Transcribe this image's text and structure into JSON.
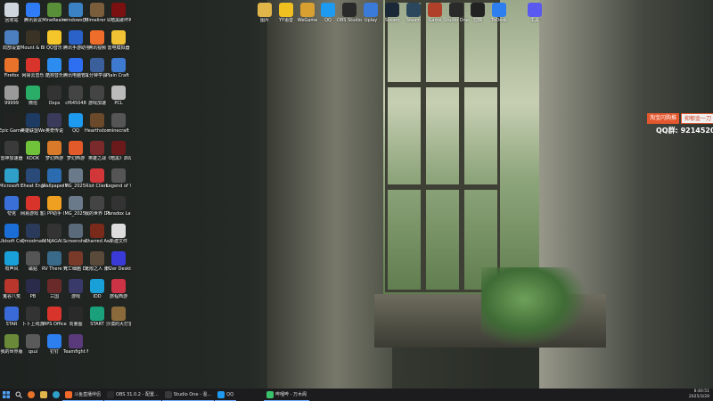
{
  "desktop": {
    "icons_left": [
      {
        "label": "回收站",
        "icon": "recycle-bin-icon",
        "color": "#d0d6de"
      },
      {
        "label": "腾讯会议",
        "icon": "tencent-meeting-icon",
        "color": "#2f7cf6"
      },
      {
        "label": "MineRealm",
        "icon": "minecraft-icon",
        "color": "#5a8f3a"
      },
      {
        "label": "windows优化",
        "icon": "windows-optimizer-icon",
        "color": "#3b82c4"
      },
      {
        "label": "Mimelirer Life Sim",
        "icon": "game-icon",
        "color": "#7a5e3c"
      },
      {
        "label": "《暗黑破坏神 IV》",
        "icon": "diablo-icon",
        "color": "#7a1010"
      },
      {
        "label": "局部设置",
        "icon": "settings-icon",
        "color": "#4c7fbf"
      },
      {
        "label": "Mount & Blade II",
        "icon": "mount-blade-icon",
        "color": "#3b3226"
      },
      {
        "label": "QQ音乐",
        "icon": "qq-music-icon",
        "color": "#f4c62b"
      },
      {
        "label": "腾讯手游助手 Demo",
        "icon": "tencent-mobile-icon",
        "color": "#2a62c9"
      },
      {
        "label": "腾讯视频",
        "icon": "tencent-video-icon",
        "color": "#ee6d2b"
      },
      {
        "label": "雷电模拟器",
        "icon": "ldplayer-icon",
        "color": "#f0c234"
      },
      {
        "label": "Firefox",
        "icon": "firefox-icon",
        "color": "#e8722a"
      },
      {
        "label": "网易云音乐",
        "icon": "netease-music-icon",
        "color": "#d8342c"
      },
      {
        "label": "酷狗音乐",
        "icon": "kugou-icon",
        "color": "#2d8cf0"
      },
      {
        "label": "腾讯电脑管家",
        "icon": "pc-manager-icon",
        "color": "#2d6ff0"
      },
      {
        "label": "三分钟学会 游戏",
        "icon": "game-icon",
        "color": "#3a5f9a"
      },
      {
        "label": "Plain Craft Launcher 2",
        "icon": "pcl-icon",
        "color": "#3f7ad1"
      },
      {
        "label": "99999",
        "icon": "app-icon",
        "color": "#9a9a9a"
      },
      {
        "label": "微信",
        "icon": "wechat-icon",
        "color": "#2aae67"
      },
      {
        "label": "Oops",
        "icon": "oops-icon",
        "color": "#333333"
      },
      {
        "label": "cf645048",
        "icon": "app-icon",
        "color": "#444444"
      },
      {
        "label": "游戏加速",
        "icon": "accelerator-icon",
        "color": "#444444"
      },
      {
        "label": "PCL",
        "icon": "pcl-icon",
        "color": "#bbbbbb"
      },
      {
        "label": "Epic Games Launcher",
        "icon": "epic-icon",
        "color": "#222222"
      },
      {
        "label": "英雄联盟WeGame 版",
        "icon": "lol-icon",
        "color": "#1d3a63"
      },
      {
        "label": "奥奇传说",
        "icon": "game-icon",
        "color": "#3a3a5a"
      },
      {
        "label": "QQ",
        "icon": "qq-icon",
        "color": "#1e9bf0"
      },
      {
        "label": "Hearthstone",
        "icon": "hearthstone-icon",
        "color": "#6a4a2a"
      },
      {
        "label": "minecraft",
        "icon": "minecraft-icon",
        "color": "#555555"
      },
      {
        "label": "雷神加速器",
        "icon": "accelerator-icon",
        "color": "#3a3a3a"
      },
      {
        "label": "KOOK",
        "icon": "kook-icon",
        "color": "#6fc23a"
      },
      {
        "label": "梦幻西游",
        "icon": "game-icon",
        "color": "#d97a2a"
      },
      {
        "label": "梦幻西游",
        "icon": "game-icon",
        "color": "#e25a2a"
      },
      {
        "label": "英雄之战",
        "icon": "game-icon",
        "color": "#7a2a2a"
      },
      {
        "label": "《暗黑》启动器",
        "icon": "diablo-icon",
        "color": "#6a1a1a"
      },
      {
        "label": "Microsoft Edge",
        "icon": "edge-icon",
        "color": "#2fa0c9"
      },
      {
        "label": "Cheat Engine.exe",
        "icon": "cheat-engine-icon",
        "color": "#2a4a7a"
      },
      {
        "label": "Wallpaper Engine",
        "icon": "wallpaper-engine-icon",
        "color": "#2b6cb0"
      },
      {
        "label": "IMG_2025…",
        "icon": "image-file-icon",
        "color": "#6a7a8a"
      },
      {
        "label": "Riot Client",
        "icon": "riot-icon",
        "color": "#d13639"
      },
      {
        "label": "Legend of YMIR",
        "icon": "game-icon",
        "color": "#555555"
      },
      {
        "label": "夸克",
        "icon": "quark-icon",
        "color": "#3a6fd8"
      },
      {
        "label": "网易游戏 客户端",
        "icon": "netease-game-icon",
        "color": "#d8342c"
      },
      {
        "label": "PP助手",
        "icon": "pp-icon",
        "color": "#f0a020"
      },
      {
        "label": "IMG_2025…",
        "icon": "image-file-icon",
        "color": "#6a7a8a"
      },
      {
        "label": "我的世界 DEMO",
        "icon": "minecraft-icon",
        "color": "#444444"
      },
      {
        "label": "Paradox Launcher v2",
        "icon": "paradox-icon",
        "color": "#333333"
      },
      {
        "label": "Ubisoft Connect",
        "icon": "ubisoft-icon",
        "color": "#1b6ed6"
      },
      {
        "label": "Qmodman",
        "icon": "app-icon",
        "color": "#2a3a5a"
      },
      {
        "label": "NINJAGAI…",
        "icon": "game-icon",
        "color": "#333333"
      },
      {
        "label": "Screenshot…",
        "icon": "image-file-icon",
        "color": "#5a6a7a"
      },
      {
        "label": "Charred Awaits…",
        "icon": "game-icon",
        "color": "#7a2a1a"
      },
      {
        "label": "新建文件",
        "icon": "file-icon",
        "color": "#dddddd"
      },
      {
        "label": "有声风",
        "icon": "app-icon",
        "color": "#1aa0d8"
      },
      {
        "label": "磁贴",
        "icon": "app-icon",
        "color": "#555555"
      },
      {
        "label": "RV There Yet",
        "icon": "game-icon",
        "color": "#3a6a8a"
      },
      {
        "label": "死亡细胞 Demo",
        "icon": "game-icon",
        "color": "#7a3a2a"
      },
      {
        "label": "无限之人 限制之间",
        "icon": "game-icon",
        "color": "#5a4a3a"
      },
      {
        "label": "H2er Desktop",
        "icon": "app-icon",
        "color": "#3a3ad8"
      },
      {
        "label": "鬼谷八荒",
        "icon": "game-icon",
        "color": "#b8362c"
      },
      {
        "label": "PB",
        "icon": "game-icon",
        "color": "#2a2a4a"
      },
      {
        "label": "三国",
        "icon": "game-icon",
        "color": "#6a2a2a"
      },
      {
        "label": "游戏",
        "icon": "game-icon",
        "color": "#3a3a6a"
      },
      {
        "label": "IDD",
        "icon": "app-icon",
        "color": "#1aa0d8"
      },
      {
        "label": "旅程西游",
        "icon": "game-icon",
        "color": "#cc3344"
      },
      {
        "label": "STAR",
        "icon": "game-icon",
        "color": "#3a6ad8"
      },
      {
        "label": "卜卜上线游",
        "icon": "app-icon",
        "color": "#333333"
      },
      {
        "label": "WPS Office",
        "icon": "wps-icon",
        "color": "#d8342c"
      },
      {
        "label": "向量图",
        "icon": "app-icon",
        "color": "#2a2a2a"
      },
      {
        "label": "START",
        "icon": "start-app-icon",
        "color": "#1aa07a"
      },
      {
        "label": "沙漠的大打雷",
        "icon": "game-icon",
        "color": "#8a6a3a"
      },
      {
        "label": "我的世界版",
        "icon": "game-icon",
        "color": "#6a8a3a"
      },
      {
        "label": "qsui",
        "icon": "app-icon",
        "color": "#5a5a5a"
      },
      {
        "label": "钉钉",
        "icon": "dingtalk-icon",
        "color": "#2d7ff0"
      },
      {
        "label": "Teamfight Manager",
        "icon": "game-icon",
        "color": "#5a3a7a"
      }
    ],
    "icons_top": [
      {
        "label": "图片",
        "icon": "folder-icon",
        "color": "#e0b64a"
      },
      {
        "label": "YY语音",
        "icon": "yy-icon",
        "color": "#f0c020"
      },
      {
        "label": "WeGame",
        "icon": "wegame-icon",
        "color": "#d8a030"
      },
      {
        "label": "QQ",
        "icon": "qq-icon",
        "color": "#1e9bf0"
      },
      {
        "label": "OBS Studio",
        "icon": "obs-icon",
        "color": "#2a2a2a"
      },
      {
        "label": "Uplay",
        "icon": "app-icon",
        "color": "#3a7ad8"
      },
      {
        "label": "Steam",
        "icon": "steam-icon",
        "color": "#1b2838"
      },
      {
        "label": "Steam",
        "icon": "steam-icon",
        "color": "#2a475e"
      },
      {
        "label": "Game",
        "icon": "game-icon",
        "color": "#b0402a"
      },
      {
        "label": "Studio One",
        "icon": "studio-one-icon",
        "color": "#2a2a2a"
      },
      {
        "label": "剪映",
        "icon": "capcut-icon",
        "color": "#222222"
      },
      {
        "label": "ToDesk",
        "icon": "todesk-icon",
        "color": "#2d7ff0"
      },
      {
        "label": "工具",
        "icon": "app-icon",
        "color": "#5a5af0"
      }
    ]
  },
  "overlay": {
    "promo_left": "淘宝闪购推",
    "promo_right": "抑郁金一刀",
    "qq_group": "QQ群: 921452052"
  },
  "taskbar": {
    "start_icon": "windows-start-icon",
    "tasks": [
      {
        "label": "斗鱼直播伴侣",
        "icon": "douyu-icon",
        "color": "#f26a2a"
      },
      {
        "label": "OBS 31.0.2 - 配置...",
        "icon": "obs-icon",
        "color": "#2a2a2a"
      },
      {
        "label": "Studio One - 混...",
        "icon": "studio-one-icon",
        "color": "#3a3a3a"
      },
      {
        "label": "QQ",
        "icon": "qq-icon",
        "color": "#1e9bf0"
      },
      {
        "label": "哔哩哔 - 万木阁",
        "icon": "bilibili-icon",
        "color": "#3ac26a"
      }
    ],
    "clock_time": "8:40:51",
    "clock_date": "2025/3/29"
  }
}
